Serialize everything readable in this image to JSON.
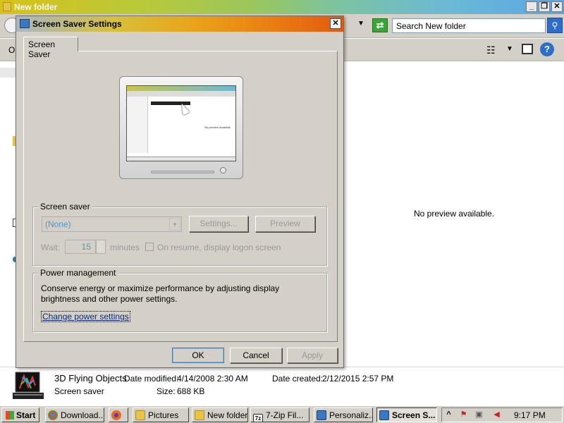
{
  "explorer": {
    "title": "New folder",
    "search_placeholder": "Search New folder",
    "organize_label_fragment": "Or",
    "preview_message": "No preview available.",
    "details": {
      "name": "3D Flying Objects",
      "type": "Screen saver",
      "date_modified_label": "Date modified:",
      "date_modified_value": "4/14/2008 2:30 AM",
      "size_label": "Size:",
      "size_value": "688 KB",
      "date_created_label": "Date created:",
      "date_created_value": "2/12/2015 2:57 PM"
    }
  },
  "dialog": {
    "title": "Screen Saver Settings",
    "close_glyph": "✕",
    "tab_label": "Screen Saver",
    "preview_inner_text": "No preview available.",
    "screen_saver_group": {
      "label": "Screen saver",
      "selected": "(None)",
      "settings_button": "Settings...",
      "preview_button": "Preview",
      "wait_label": "Wait:",
      "wait_value": "15",
      "wait_unit": "minutes",
      "resume_label": "On resume, display logon screen",
      "resume_checked": false
    },
    "power_group": {
      "label": "Power management",
      "description": "Conserve energy or maximize performance by adjusting display brightness and other power settings.",
      "link": "Change power settings"
    },
    "buttons": {
      "ok": "OK",
      "cancel": "Cancel",
      "apply": "Apply"
    }
  },
  "taskbar": {
    "start": "Start",
    "items": [
      {
        "label": "Download...",
        "icon": "chrome-icon",
        "color": "#2f8fdc"
      },
      {
        "label": "",
        "icon": "firefox-icon",
        "color": "#e66a1f"
      },
      {
        "label": "Pictures",
        "icon": "folder-icon",
        "color": "#e8c34a"
      },
      {
        "label": "New folder",
        "icon": "folder-icon",
        "color": "#e8c34a"
      },
      {
        "label": "7-Zip Fil...",
        "icon": "7zip-icon",
        "color": "#222222"
      },
      {
        "label": "Personaliz...",
        "icon": "display-icon",
        "color": "#3a78c2"
      },
      {
        "label": "Screen S...",
        "icon": "monitor-icon",
        "color": "#3a78c2"
      }
    ],
    "clock": "9:17 PM"
  }
}
